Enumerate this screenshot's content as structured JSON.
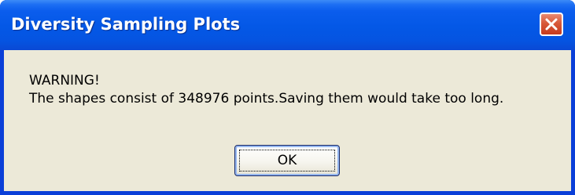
{
  "window": {
    "title": "Diversity Sampling Plots",
    "close_icon": "close-x-icon",
    "colors": {
      "titlebar": "#0458e6",
      "client": "#ece9d8",
      "close_button": "#d8593a"
    }
  },
  "dialog": {
    "heading": "WARNING!",
    "message": "The shapes consist of 348976 points.Saving them would take too long."
  },
  "buttons": {
    "ok_label": "OK"
  }
}
